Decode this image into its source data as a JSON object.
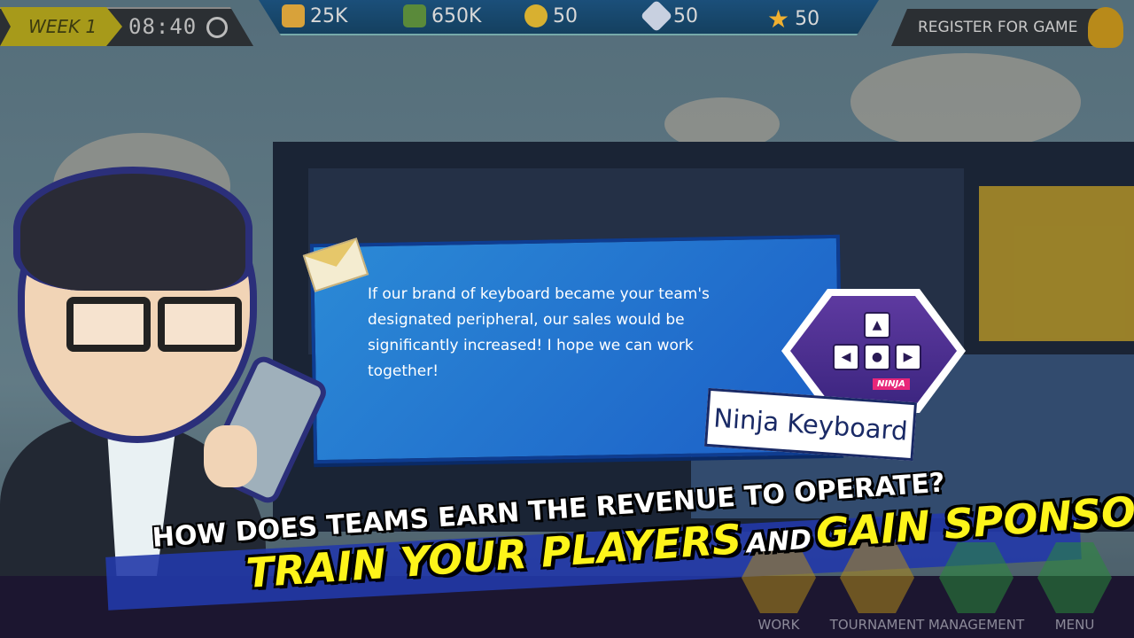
{
  "hud": {
    "week": "WEEK 1",
    "timer": "08:40",
    "register_label": "REGISTER FOR GAME"
  },
  "resources": [
    {
      "icon": "card-icon",
      "value": "25K",
      "color": "#d8a23a"
    },
    {
      "icon": "cash-icon",
      "value": "650K",
      "color": "#5a8a3a"
    },
    {
      "icon": "bulb-icon",
      "value": "50",
      "color": "#d8b030"
    },
    {
      "icon": "strategy-icon",
      "value": "50",
      "color": "#c8d0e0"
    },
    {
      "icon": "star-icon",
      "value": "50",
      "color": "#f0b030"
    }
  ],
  "dialog": {
    "message": "If our brand of keyboard became your team's designated peripheral, our sales would be significantly increased! I hope we can work together!",
    "sponsor_name": "Ninja Keyboard",
    "sponsor_logo_text": "NINJA"
  },
  "promo": {
    "line1": "HOW DOES TEAMS EARN THE REVENUE TO OPERATE?",
    "train": "TRAIN YOUR PLAYERS",
    "and": "AND",
    "gain": "GAIN SPONSORSHIP."
  },
  "nav": [
    {
      "label": "WORK",
      "color": "#b08a1a"
    },
    {
      "label": "TOURNAMENT",
      "color": "#b08a1a"
    },
    {
      "label": "MANAGEMENT",
      "color": "#2a8a3a"
    },
    {
      "label": "MENU",
      "color": "#2a8a3a"
    }
  ]
}
